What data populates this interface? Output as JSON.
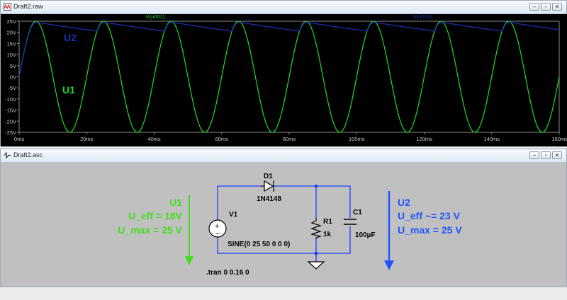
{
  "waveform_window": {
    "title": "Draft2.raw",
    "trace1_label": "V(n001)",
    "trace2_label": "V(n003)",
    "y_ticks": [
      "25V",
      "20V",
      "15V",
      "10V",
      "5V",
      "0V",
      "-5V",
      "-10V",
      "-15V",
      "-20V",
      "-25V"
    ],
    "x_ticks": [
      "0ms",
      "20ms",
      "40ms",
      "60ms",
      "80ms",
      "100ms",
      "120ms",
      "140ms",
      "160ms"
    ],
    "u1_label": "U1",
    "u2_label": "U2",
    "colors": {
      "background": "#000000",
      "u1": "#22dd22",
      "u2": "#1c2fb0",
      "axis": "#8a8a8a"
    }
  },
  "schematic_window": {
    "title": "Draft2.asc",
    "diode_name": "D1",
    "diode_model": "1N4148",
    "source_name": "V1",
    "source_spec": "SINE(0 25 50 0 0 0)",
    "resistor_name": "R1",
    "resistor_value": "1k",
    "capacitor_name": "C1",
    "capacitor_value": "100µF",
    "directive": ".tran 0 0.16 0",
    "u1_title": "U1",
    "u1_eff": "U_eff = 18V",
    "u1_max": "U_max = 25 V",
    "u2_title": "U2",
    "u2_eff": "U_eff ~= 23 V",
    "u2_max": "U_max = 25 V",
    "colors": {
      "wire": "#1e3cff",
      "green": "#44dd22",
      "blue": "#2255ff",
      "background": "#c0c0c0"
    }
  },
  "chart_data": {
    "type": "line",
    "title": "",
    "xlabel": "",
    "ylabel": "",
    "xlim": [
      0,
      160
    ],
    "ylim": [
      -25,
      25
    ],
    "x_unit": "ms",
    "y_unit": "V",
    "series": [
      {
        "name": "V(n001)",
        "description": "sine 25 V amplitude, 50 Hz",
        "x": [
          0,
          5,
          10,
          15,
          20,
          25,
          30,
          35,
          40,
          45,
          50,
          55,
          60,
          65,
          70,
          75,
          80,
          85,
          90,
          95,
          100,
          105,
          110,
          115,
          120,
          125,
          130,
          135,
          140,
          145,
          150,
          155,
          160
        ],
        "y": [
          0,
          25,
          0,
          -25,
          0,
          25,
          0,
          -25,
          0,
          25,
          0,
          -25,
          0,
          25,
          0,
          -25,
          0,
          25,
          0,
          -25,
          0,
          25,
          0,
          -25,
          0,
          25,
          0,
          -25,
          0,
          25,
          0,
          -25,
          0
        ]
      },
      {
        "name": "V(n003)",
        "description": "rectified and smoothed output",
        "x": [
          0,
          5,
          25,
          45,
          65,
          85,
          105,
          125,
          145,
          160
        ],
        "y": [
          0,
          24.6,
          24.6,
          24.6,
          24.6,
          24.6,
          24.6,
          24.6,
          24.6,
          21.3
        ]
      }
    ]
  }
}
